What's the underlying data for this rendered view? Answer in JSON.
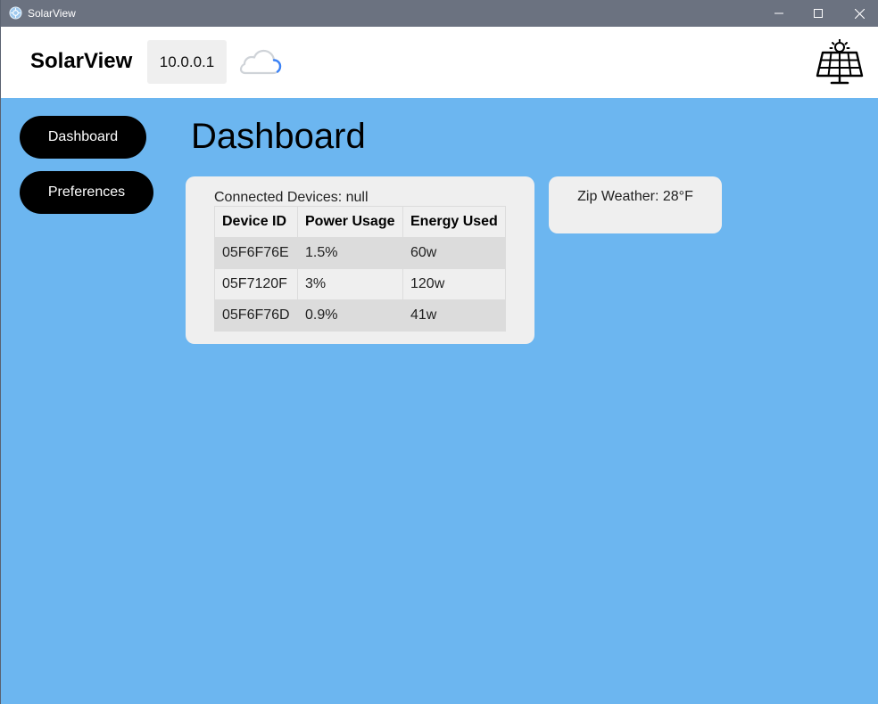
{
  "window": {
    "title": "SolarView",
    "minimize_icon": "minimize-icon",
    "maximize_icon": "maximize-icon",
    "close_icon": "close-icon"
  },
  "header": {
    "brand": "SolarView",
    "ip_address": "10.0.0.1",
    "cloud_icon": "cloud-icon",
    "panel_icon": "solar-panel-icon"
  },
  "sidebar": {
    "items": [
      {
        "label": "Dashboard"
      },
      {
        "label": "Preferences"
      }
    ]
  },
  "main": {
    "title": "Dashboard",
    "devices": {
      "caption": "Connected Devices: null",
      "columns": [
        "Device ID",
        "Power Usage",
        "Energy Used"
      ],
      "rows": [
        [
          "05F6F76E",
          "1.5%",
          "60w"
        ],
        [
          "05F7120F",
          "3%",
          "120w"
        ],
        [
          "05F6F76D",
          "0.9%",
          "41w"
        ]
      ]
    },
    "weather": {
      "text": "Zip Weather: 28°F"
    }
  },
  "colors": {
    "background": "#6cb6f0",
    "titlebar": "#6b7280",
    "card": "#efefef",
    "nav_button": "#000000",
    "cloud_accent": "#3b82f6"
  }
}
